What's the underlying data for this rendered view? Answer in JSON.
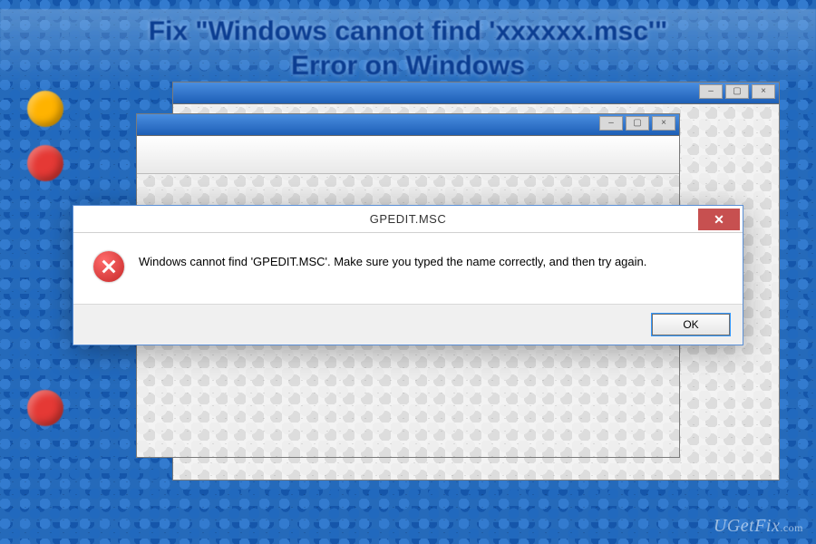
{
  "banner": {
    "line1": "Fix \"Windows cannot find 'xxxxxx.msc'\"",
    "line2": "Error on Windows"
  },
  "dialog": {
    "title": "GPEDIT.MSC",
    "message": "Windows cannot find 'GPEDIT.MSC'. Make sure you typed the name correctly, and then try again.",
    "ok_label": "OK",
    "close_label": "✕"
  },
  "watermark": {
    "brand": "UGetFix",
    "domain": ".com"
  },
  "icons": {
    "error": "error-circle",
    "close": "close-x"
  }
}
